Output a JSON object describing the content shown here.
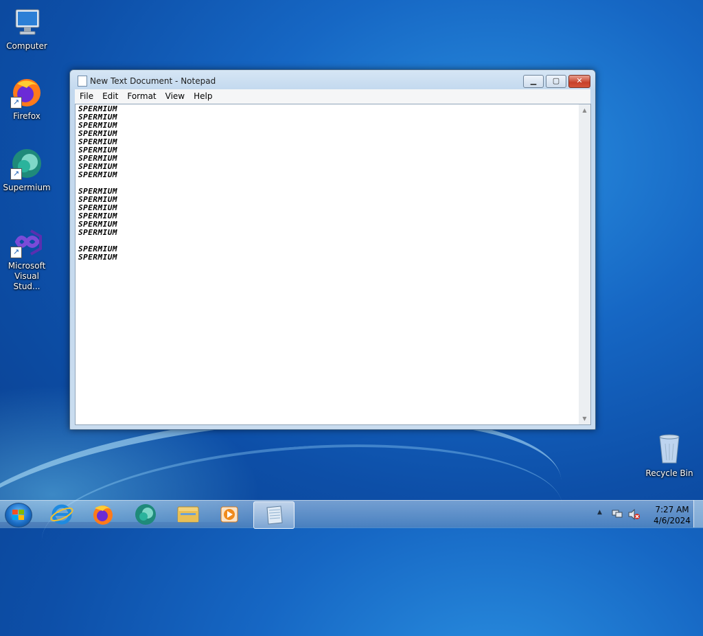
{
  "desktop_icons": [
    {
      "label": "Computer",
      "icon": "computer-icon"
    },
    {
      "label": "Firefox",
      "icon": "firefox-icon"
    },
    {
      "label": "Supermium",
      "icon": "supermium-icon"
    },
    {
      "label": "Microsoft Visual Stud...",
      "icon": "visual-studio-icon"
    },
    {
      "label": "Recycle Bin",
      "icon": "recycle-bin-icon"
    }
  ],
  "window": {
    "title": "New Text Document - Notepad",
    "min_label": "▁",
    "max_label": "▢",
    "close_label": "✕"
  },
  "menu": [
    "File",
    "Edit",
    "Format",
    "View",
    "Help"
  ],
  "document": {
    "lines": [
      "SPERMIUM",
      "SPERMIUM",
      "SPERMIUM",
      "SPERMIUM",
      "SPERMIUM",
      "SPERMIUM",
      "SPERMIUM",
      "SPERMIUM",
      "SPERMIUM",
      "",
      "SPERMIUM",
      "SPERMIUM",
      "SPERMIUM",
      "SPERMIUM",
      "SPERMIUM",
      "SPERMIUM",
      "",
      "SPERMIUM",
      "SPERMIUM"
    ]
  },
  "taskbar": {
    "pinned": [
      "internet-explorer-icon",
      "firefox-icon",
      "supermium-icon",
      "file-explorer-icon",
      "media-player-icon",
      "notepad-icon"
    ],
    "active": "notepad-icon"
  },
  "tray": {
    "time": "7:27 AM",
    "date": "4/6/2024",
    "show_hidden_label": "▲"
  },
  "colors": {
    "desktop": "#1667c4",
    "close_button": "#c8412a"
  }
}
